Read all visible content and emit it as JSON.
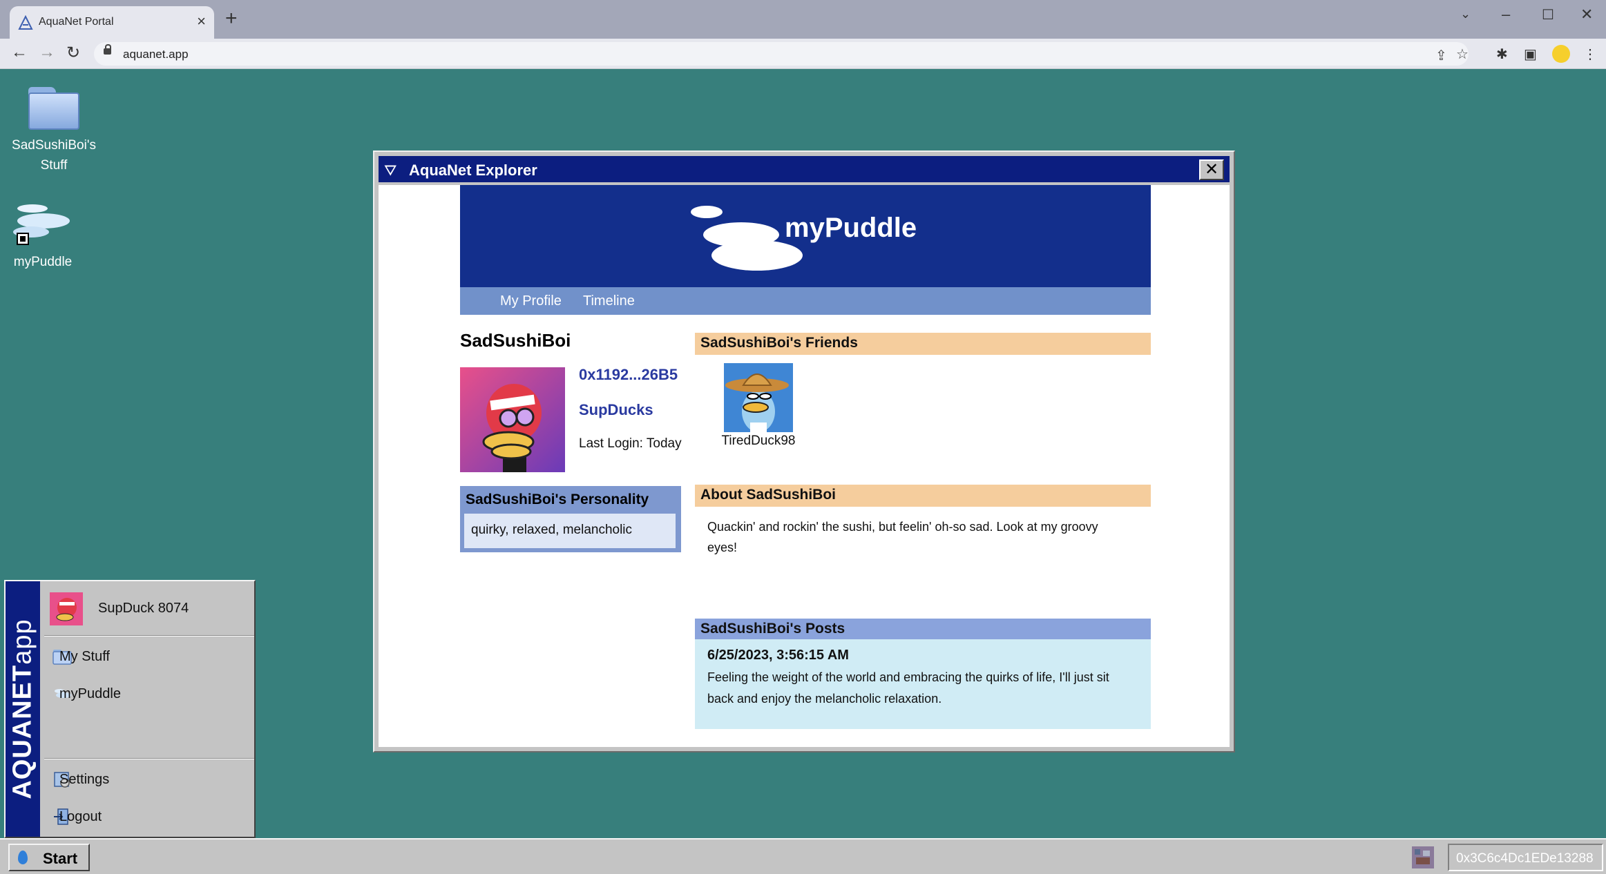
{
  "browser": {
    "tab_title": "AquaNet Portal",
    "url": "aquanet.app"
  },
  "desktop": {
    "icons": [
      {
        "label_line1": "SadSushiBoi's",
        "label_line2": "Stuff",
        "icon": "folder-icon"
      },
      {
        "label": "myPuddle",
        "icon": "puddle-shortcut-icon"
      }
    ]
  },
  "window": {
    "title": "AquaNet Explorer",
    "close_label": "✕"
  },
  "site": {
    "logo_text": "myPuddle",
    "nav": [
      "My Profile",
      "Timeline"
    ]
  },
  "profile": {
    "username": "SadSushiBoi",
    "wallet": "0x1192...26B5",
    "collection": "SupDucks",
    "last_login": "Last Login: Today",
    "personality_title": "SadSushiBoi's Personality",
    "personality": "quirky, relaxed, melancholic"
  },
  "friends": {
    "title": "SadSushiBoi's Friends",
    "items": [
      {
        "name": "TiredDuck98"
      }
    ]
  },
  "about": {
    "title": "About SadSushiBoi",
    "text": "Quackin' and rockin' the sushi, but feelin' oh-so sad. Look at my groovy eyes!"
  },
  "posts": {
    "title": "SadSushiBoi's Posts",
    "items": [
      {
        "date": "6/25/2023, 3:56:15 AM",
        "text": "Feeling the weight of the world and embracing the quirks of life, I'll just sit back and enjoy the melancholic relaxation."
      }
    ]
  },
  "start_menu": {
    "brand_bold": "AQUANET",
    "brand_light": "app",
    "user": "SupDuck 8074",
    "items": [
      "My Stuff",
      "myPuddle"
    ],
    "system_items": [
      "Settings",
      "Logout"
    ]
  },
  "taskbar": {
    "start_label": "Start",
    "address": "0x3C6c4Dc1EDe13288"
  },
  "colors": {
    "desktop": "#377f7c",
    "titlebar": "#0c1e80",
    "banner": "#132f8c",
    "navbar": "#7191ca",
    "link": "#2a3aa0",
    "section_orange": "#f5cd9d",
    "section_blue": "#8aa3dc"
  }
}
